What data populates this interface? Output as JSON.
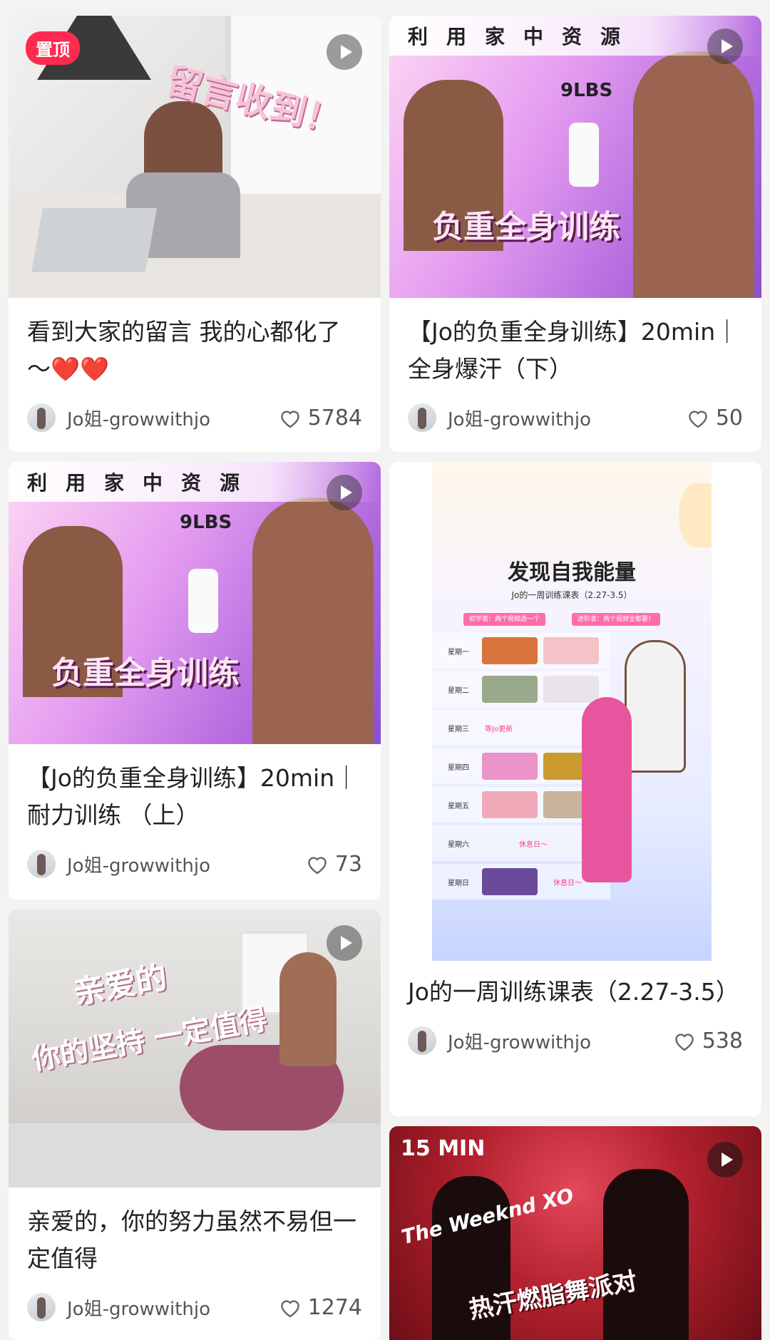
{
  "feed": {
    "cards": [
      {
        "pin_badge": "置顶",
        "thumb_caption": "留言收到！",
        "title": "看到大家的留言 我的心都化了～❤️❤️",
        "author": "Jo姐-growwithjo",
        "likes": "5784"
      },
      {
        "thumb_banner": "利用家中资源",
        "thumb_weight": "9LBS",
        "thumb_caption": "负重全身训练",
        "title": "【Jo的负重全身训练】20min｜全身爆汗（下）",
        "author": "Jo姐-growwithjo",
        "likes": "50"
      },
      {
        "thumb_banner": "利用家中资源",
        "thumb_weight": "9LBS",
        "thumb_caption": "负重全身训练",
        "title": "【Jo的负重全身训练】20min｜耐力训练 （上）",
        "author": "Jo姐-growwithjo",
        "likes": "73"
      },
      {
        "poster": {
          "title": "发现自我能量",
          "subtitle": "Jo的一周训练课表（2.27-3.5）",
          "tag_left": "初学者：两个视频选一个",
          "tag_right": "进阶者：两个视频全都要！",
          "days": [
            "星期一",
            "星期二",
            "星期三",
            "星期四",
            "星期五",
            "星期六",
            "星期日"
          ],
          "wed_note": "等Jo更新",
          "sat_note": "休息日～",
          "sun_note": "休息日～"
        },
        "title": "Jo的一周训练课表（2.27-3.5）",
        "author": "Jo姐-growwithjo",
        "likes": "538"
      },
      {
        "thumb_caption_line1": "亲爱的",
        "thumb_caption_line2": "你的坚持 一定值得",
        "title": "亲爱的，你的努力虽然不易但一定值得",
        "author": "Jo姐-growwithjo",
        "likes": "1274"
      },
      {
        "thumb_top": "15 MIN",
        "thumb_brand": "The Weeknd XO",
        "thumb_caption": "热汗燃脂舞派对"
      }
    ]
  },
  "colors": {
    "pin": "#ff2a4f",
    "accent_pink": "#ff3d85"
  },
  "icons": {
    "like": "heart-outline-icon",
    "video": "play-icon"
  }
}
